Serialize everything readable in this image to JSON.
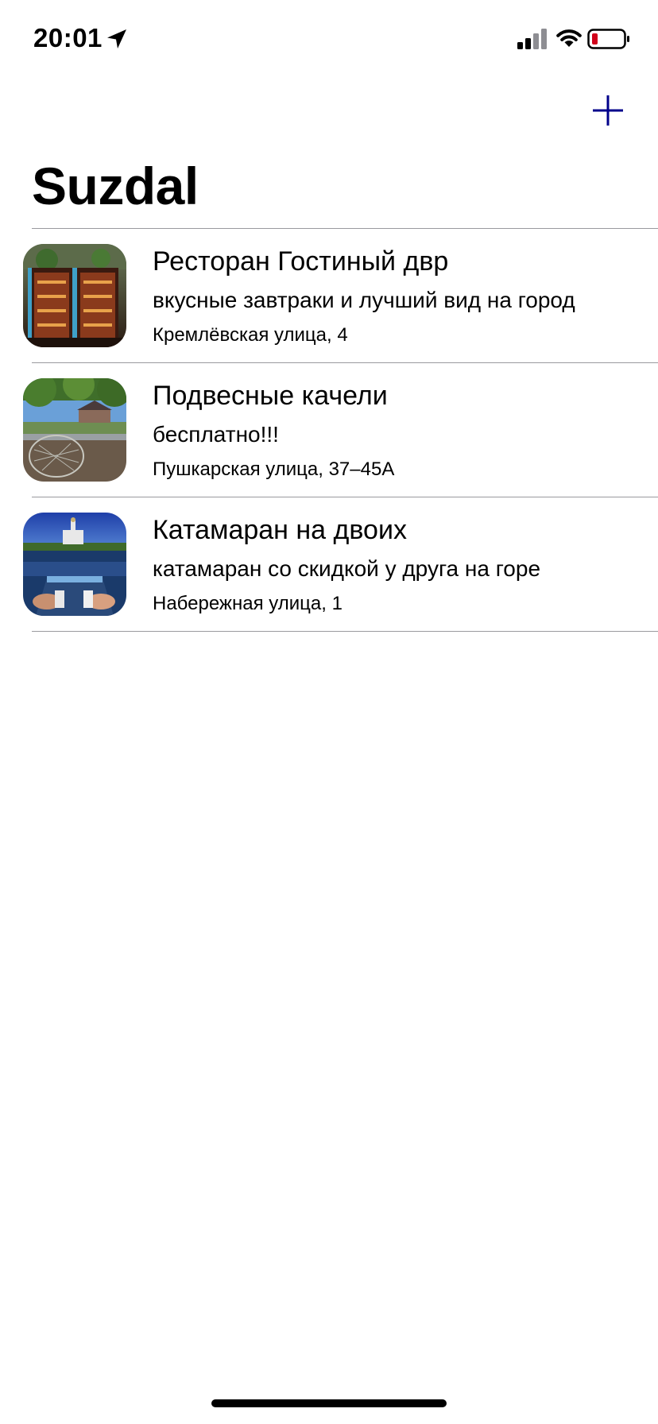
{
  "status_bar": {
    "time": "20:01",
    "icons": [
      "location-arrow-icon",
      "cellular-signal-icon",
      "wifi-icon",
      "battery-low-icon"
    ]
  },
  "nav": {
    "add_icon": "plus-icon",
    "accent_color": "#00008B",
    "title": "Suzdal"
  },
  "places": [
    {
      "name": "Ресторан Гостиный двр",
      "description": "вкусные завтраки и лучший вид на город",
      "address": "Кремлёвская улица, 4"
    },
    {
      "name": "Подвесные качели",
      "description": "бесплатно!!!",
      "address": "Пушкарская улица, 37–45А"
    },
    {
      "name": "Катамаран на двоих",
      "description": "катамаран со скидкой у друга на горе",
      "address": "Набережная улица, 1"
    }
  ],
  "colors": {
    "battery_low": "#D0021B",
    "separator": "#9A9A9E"
  }
}
